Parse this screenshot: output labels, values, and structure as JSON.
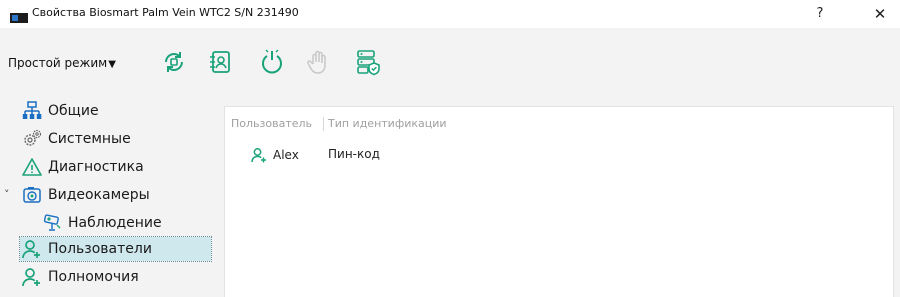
{
  "window": {
    "title": "Свойства Biosmart Palm Vein WTC2 S/N 231490",
    "help_label": "?",
    "close_label": "✕"
  },
  "toolbar": {
    "mode_label": "Простой режим",
    "mode_caret": "▼",
    "tools": [
      {
        "name": "sync-icon",
        "enabled": true
      },
      {
        "name": "user-card-icon",
        "enabled": true
      },
      {
        "name": "power-icon",
        "enabled": true
      },
      {
        "name": "palm-icon",
        "enabled": false
      },
      {
        "name": "server-shield-icon",
        "enabled": true
      }
    ]
  },
  "sidebar": {
    "items": [
      {
        "label": "Общие",
        "icon": "network-icon"
      },
      {
        "label": "Системные",
        "icon": "gears-icon"
      },
      {
        "label": "Диагностика",
        "icon": "warning-icon"
      },
      {
        "label": "Видеокамеры",
        "icon": "camera-icon",
        "expanded": true
      },
      {
        "label": "Наблюдение",
        "icon": "cctv-icon"
      },
      {
        "label": "Пользователи",
        "icon": "user-add-icon",
        "selected": true
      },
      {
        "label": "Полномочия",
        "icon": "user-add-icon"
      }
    ],
    "expander_glyph": "˅"
  },
  "table": {
    "columns": [
      "Пользователь",
      "Тип идентификации"
    ],
    "rows": [
      {
        "user": "Alex",
        "id_type": "Пин-код"
      }
    ]
  },
  "colors": {
    "accent": "#1aa37a",
    "selected_bg": "#cfe8ee"
  }
}
